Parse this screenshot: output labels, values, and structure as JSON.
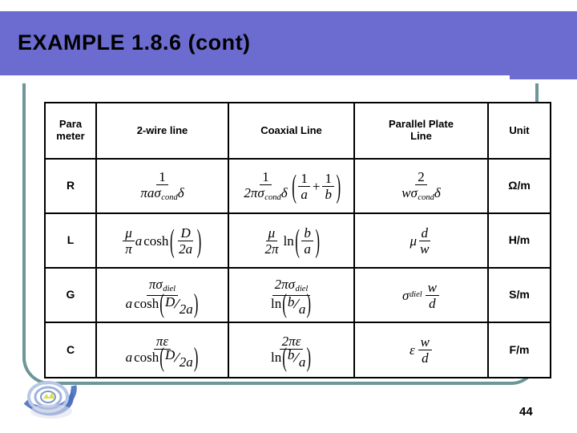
{
  "slide": {
    "title": "EXAMPLE 1.8.6 (cont)",
    "page_number": "44",
    "banner_color": "#6c6cd0",
    "frame_color": "#6d9698",
    "logo_name": "company-swirl-logo"
  },
  "table": {
    "headers": {
      "parameter": "Para meter",
      "parameter_line1": "Para",
      "parameter_line2": "meter",
      "two_wire": "2-wire line",
      "coaxial": "Coaxial Line",
      "parallel_plate_line1": "Parallel Plate",
      "parallel_plate_line2": "Line",
      "unit": "Unit"
    },
    "rows": [
      {
        "parameter": "R",
        "two_wire_formula": "1 / (π a σ_cond δ)",
        "coaxial_formula": "1 / (2π σ_cond δ) · (1/a + 1/b)",
        "parallel_plate_formula": "2 / (w σ_cond δ)",
        "unit": "Ω/m"
      },
      {
        "parameter": "L",
        "two_wire_formula": "(μ/π) a cosh(D / 2a)",
        "coaxial_formula": "(μ/2π) ln(b / a)",
        "parallel_plate_formula": "μ d / w",
        "unit": "H/m"
      },
      {
        "parameter": "G",
        "two_wire_formula": "πσ_diel / (a cosh(D/2a))",
        "coaxial_formula": "2πσ_diel / ln(b/a)",
        "parallel_plate_formula": "σ_diel (w/d)",
        "unit": "S/m"
      },
      {
        "parameter": "C",
        "two_wire_formula": "πε / (a cosh(D/2a))",
        "coaxial_formula": "2πε / ln(b/a)",
        "parallel_plate_formula": "ε (w/d)",
        "unit": "F/m"
      }
    ],
    "symbols": {
      "one": "1",
      "two": "2",
      "pi": "π",
      "two_pi": "2π",
      "mu": "μ",
      "epsilon": "ε",
      "sigma": "σ",
      "delta": "δ",
      "a": "a",
      "b": "b",
      "d": "d",
      "w": "w",
      "D": "D",
      "two_a": "2a",
      "cond": "cond",
      "diel": "diel",
      "cosh": "cosh",
      "ln": "ln",
      "plus": "+",
      "lparen": "(",
      "rparen": ")",
      "slash": "/"
    }
  }
}
